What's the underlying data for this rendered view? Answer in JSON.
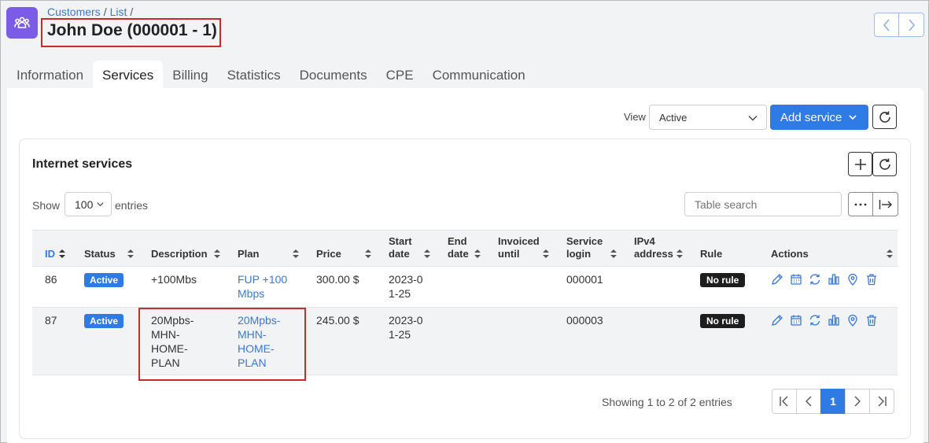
{
  "header": {
    "breadcrumb": [
      "Customers",
      "List"
    ],
    "breadcrumb_sep": "/",
    "title": "John Doe (000001 - 1)"
  },
  "tabs": [
    {
      "label": "Information",
      "active": false
    },
    {
      "label": "Services",
      "active": true
    },
    {
      "label": "Billing",
      "active": false
    },
    {
      "label": "Statistics",
      "active": false
    },
    {
      "label": "Documents",
      "active": false
    },
    {
      "label": "CPE",
      "active": false
    },
    {
      "label": "Communication",
      "active": false
    }
  ],
  "toolbar": {
    "view_label": "View",
    "view_value": "Active",
    "add_service_label": "Add service"
  },
  "section": {
    "title": "Internet services",
    "show_label": "Show",
    "entries_value": "100",
    "entries_label": "entries",
    "search_placeholder": "Table search"
  },
  "table": {
    "columns": [
      "ID",
      "Status",
      "Description",
      "Plan",
      "Price",
      "Start date",
      "End date",
      "Invoiced until",
      "Service login",
      "IPv4 address",
      "Rule",
      "Actions"
    ],
    "rows": [
      {
        "id": "86",
        "status": "Active",
        "description": "+100Mbs",
        "plan": "FUP +100 Mbps",
        "price": "300.00 $",
        "start_date": "2023-01-25",
        "end_date": "",
        "invoiced_until": "",
        "service_login": "000001",
        "ipv4": "",
        "rule": "No rule"
      },
      {
        "id": "87",
        "status": "Active",
        "description": "20Mpbs-MHN-HOME-PLAN",
        "plan": "20Mpbs-MHN-HOME-PLAN",
        "price": "245.00 $",
        "start_date": "2023-01-25",
        "end_date": "",
        "invoiced_until": "",
        "service_login": "000003",
        "ipv4": "",
        "rule": "No rule"
      }
    ]
  },
  "footer": {
    "showing_text": "Showing 1 to 2 of 2 entries",
    "current_page": "1"
  },
  "colors": {
    "accent": "#2f7be5",
    "app_icon": "#7b5ce6",
    "highlight": "#cc2a2a",
    "rule_badge": "#1e1e1e"
  },
  "icons": [
    "users-icon",
    "chevron-left-icon",
    "chevron-right-icon",
    "chevron-down-icon",
    "refresh-icon",
    "plus-icon",
    "more-icon",
    "export-icon",
    "sort-icon",
    "edit-icon",
    "calendar-icon",
    "change-plan-icon",
    "statistics-icon",
    "location-icon",
    "trash-icon",
    "first-page-icon",
    "last-page-icon"
  ]
}
